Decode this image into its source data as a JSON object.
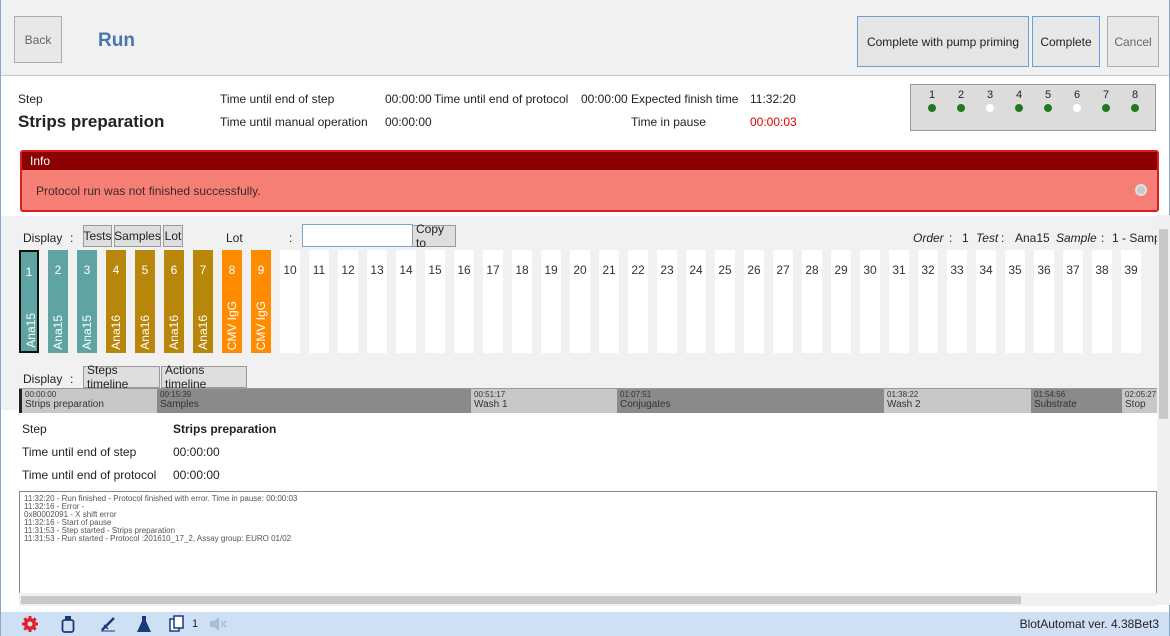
{
  "header": {
    "back_label": "Back",
    "title": "Run",
    "pump_label": "Complete with pump priming",
    "complete_label": "Complete",
    "cancel_label": "Cancel"
  },
  "status": {
    "step_label": "Step",
    "step_name": "Strips preparation",
    "time_end_step_label": "Time until end of step",
    "time_end_step_value": "00:00:00",
    "time_end_protocol_label": "Time until end of protocol",
    "time_end_protocol_value": "00:00:00",
    "expected_finish_label": "Expected finish time",
    "expected_finish_value": "11:32:20",
    "manual_label": "Time until manual operation",
    "manual_value": "00:00:00",
    "pause_label": "Time in pause",
    "pause_value": "00:00:03"
  },
  "modules": [
    {
      "n": "1",
      "on": true
    },
    {
      "n": "2",
      "on": true
    },
    {
      "n": "3",
      "on": false
    },
    {
      "n": "4",
      "on": true
    },
    {
      "n": "5",
      "on": true
    },
    {
      "n": "6",
      "on": false
    },
    {
      "n": "7",
      "on": true
    },
    {
      "n": "8",
      "on": true
    }
  ],
  "info": {
    "header": "Info",
    "message": "Protocol run was not finished successfully."
  },
  "display_bar": {
    "display_label": "Display",
    "colon": ":",
    "tests_btn": "Tests",
    "samples_btn": "Samples",
    "lot_btn": "Lot",
    "lot_label": "Lot",
    "lot_value": "",
    "copy_btn": "Copy to",
    "order_label": "Order",
    "order_value": "1",
    "test_label": "Test",
    "test_value": "Ana15",
    "sample_label": "Sample",
    "sample_value": "1 - Samp"
  },
  "strips": [
    {
      "n": "1",
      "name": "Ana15",
      "color": "#5fa3a3",
      "selected": true
    },
    {
      "n": "2",
      "name": "Ana15",
      "color": "#5fa3a3"
    },
    {
      "n": "3",
      "name": "Ana15",
      "color": "#5fa3a3"
    },
    {
      "n": "4",
      "name": "Ana16",
      "color": "#b8860b"
    },
    {
      "n": "5",
      "name": "Ana16",
      "color": "#b8860b"
    },
    {
      "n": "6",
      "name": "Ana16",
      "color": "#b8860b"
    },
    {
      "n": "7",
      "name": "Ana16",
      "color": "#b8860b"
    },
    {
      "n": "8",
      "name": "CMV IgG",
      "color": "#ff8c00"
    },
    {
      "n": "9",
      "name": "CMV IgG",
      "color": "#ff8c00"
    },
    {
      "n": "10"
    },
    {
      "n": "11"
    },
    {
      "n": "12"
    },
    {
      "n": "13"
    },
    {
      "n": "14"
    },
    {
      "n": "15"
    },
    {
      "n": "16"
    },
    {
      "n": "17"
    },
    {
      "n": "18"
    },
    {
      "n": "19"
    },
    {
      "n": "20"
    },
    {
      "n": "21"
    },
    {
      "n": "22"
    },
    {
      "n": "23"
    },
    {
      "n": "24"
    },
    {
      "n": "25"
    },
    {
      "n": "26"
    },
    {
      "n": "27"
    },
    {
      "n": "28"
    },
    {
      "n": "29"
    },
    {
      "n": "30"
    },
    {
      "n": "31"
    },
    {
      "n": "32"
    },
    {
      "n": "33"
    },
    {
      "n": "34"
    },
    {
      "n": "35"
    },
    {
      "n": "36"
    },
    {
      "n": "37"
    },
    {
      "n": "38"
    },
    {
      "n": "39"
    }
  ],
  "timeline_bar": {
    "display_label": "Display",
    "colon": ":",
    "steps_btn": "Steps timeline",
    "actions_btn": "Actions timeline"
  },
  "timeline": [
    {
      "time": "00:00:00",
      "name": "Strips preparation",
      "color": "#c8c8c8"
    },
    {
      "time": "00:15:39",
      "name": "Samples",
      "color": "#8a8a8a"
    },
    {
      "time": "00:51:17",
      "name": "Wash 1",
      "color": "#c8c8c8"
    },
    {
      "time": "01:07:51",
      "name": "Conjugates",
      "color": "#8a8a8a"
    },
    {
      "time": "01:38:22",
      "name": "Wash 2",
      "color": "#c8c8c8"
    },
    {
      "time": "01:54:56",
      "name": "Substrate",
      "color": "#8a8a8a"
    },
    {
      "time": "02:05:27",
      "name": "Stop",
      "color": "#c8c8c8"
    }
  ],
  "details": {
    "step_label": "Step",
    "step_value": "Strips preparation",
    "time_end_step_label": "Time until end of step",
    "time_end_step_value": "00:00:00",
    "time_end_protocol_label": "Time until end of protocol",
    "time_end_protocol_value": "00:00:00"
  },
  "log": [
    "11:32:20 - Run finished - Protocol  finished with error. Time in pause: 00:00:03",
    "11:32:16 - Error -",
    "0x80002091 - X shift error",
    "11:32:16 - Start of pause",
    "11:31:53 - Step started - Strips preparation",
    "11:31:53 - Run started - Protocol :201610_17_2, Assay group: EURO 01/02"
  ],
  "footer": {
    "counter": "1",
    "version": "BlotAutomat ver. 4.38Bet3"
  }
}
